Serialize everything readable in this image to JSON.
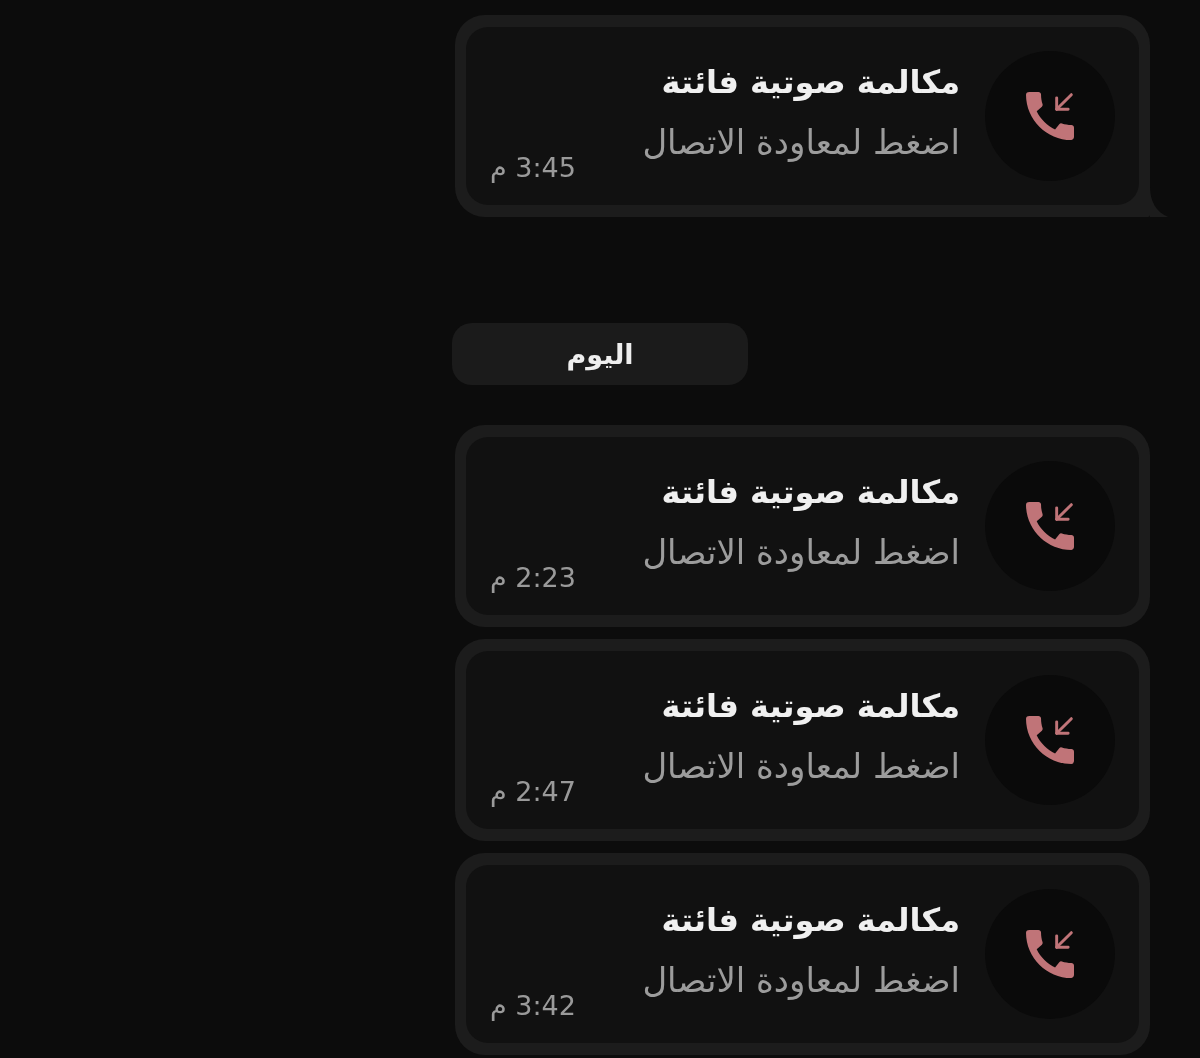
{
  "conversation": {
    "items": [
      {
        "kind": "missed_call",
        "title": "مكالمة صوتية فائتة",
        "subtitle": "اضغط لمعاودة الاتصال",
        "time": "3:45 م",
        "tail": true
      },
      {
        "kind": "date_chip",
        "label": "اليوم"
      },
      {
        "kind": "missed_call",
        "title": "مكالمة صوتية فائتة",
        "subtitle": "اضغط لمعاودة الاتصال",
        "time": "2:23 م",
        "tail": false
      },
      {
        "kind": "missed_call",
        "title": "مكالمة صوتية فائتة",
        "subtitle": "اضغط لمعاودة الاتصال",
        "time": "2:47 م",
        "tail": false
      },
      {
        "kind": "missed_call",
        "title": "مكالمة صوتية فائتة",
        "subtitle": "اضغط لمعاودة الاتصال",
        "time": "3:42 م",
        "tail": false
      }
    ]
  }
}
